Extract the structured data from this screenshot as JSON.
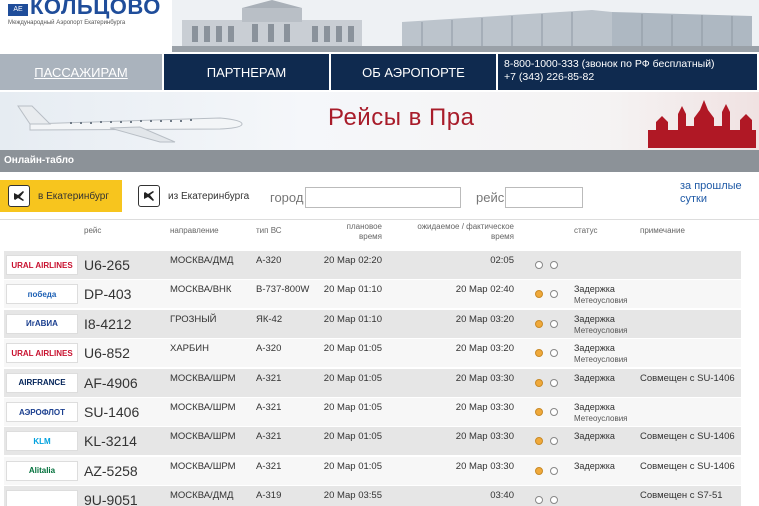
{
  "header": {
    "logo_text": "КОЛЬЦОВО",
    "logo_mark": "АЕ",
    "logo_subtitle": "Международный Аэропорт Екатеринбурга"
  },
  "nav": {
    "passengers": "ПАССАЖИРАМ",
    "partners": "ПАРТНЕРАМ",
    "about": "ОБ АЭРОПОРТЕ",
    "phone1": "8-800-1000-333 (звонок по РФ бесплатный)",
    "phone2": "+7 (343) 226-85-82"
  },
  "banner": {
    "text": "Рейсы в Пра"
  },
  "board": {
    "title": "Онлайн-табло",
    "arrivals_label": "в Екатеринбург",
    "departures_label": "из Екатеринбурга",
    "city_label": "город",
    "flight_label": "рейс",
    "past_link_line1": "за прошлые",
    "past_link_line2": "сутки"
  },
  "columns": {
    "flight": "рейс",
    "direction": "направление",
    "aircraft": "тип ВС",
    "planned_line1": "плановое",
    "planned_line2": "время",
    "expected_line1": "ожидаемое / фактическое",
    "expected_line2": "время",
    "status": "статус",
    "note": "примечание"
  },
  "flights": [
    {
      "airline": "URAL AIRLINES",
      "logo_color": "#c8102e",
      "flight": "U6-265",
      "direction": "МОСКВА/ДМД",
      "aircraft": "А-320",
      "planned": "20 Мар 02:20",
      "actual": "02:05",
      "dot1": "empty",
      "dot2": "empty",
      "status": "",
      "status_sub": "",
      "note": ""
    },
    {
      "airline": "победа",
      "logo_color": "#1b5fb4",
      "flight": "DP-403",
      "direction": "МОСКВА/ВНК",
      "aircraft": "B-737-800W",
      "planned": "20 Мар 01:10",
      "actual": "20 Мар 02:40",
      "dot1": "orange",
      "dot2": "empty",
      "status": "Задержка",
      "status_sub": "Метеоусловия",
      "note": ""
    },
    {
      "airline": "ИrАВИА",
      "logo_color": "#1b3f8f",
      "flight": "I8-4212",
      "direction": "ГРОЗНЫЙ",
      "aircraft": "ЯК-42",
      "planned": "20 Мар 01:10",
      "actual": "20 Мар 03:20",
      "dot1": "orange",
      "dot2": "empty",
      "status": "Задержка",
      "status_sub": "Метеоусловия",
      "note": ""
    },
    {
      "airline": "URAL AIRLINES",
      "logo_color": "#c8102e",
      "flight": "U6-852",
      "direction": "ХАРБИН",
      "aircraft": "А-320",
      "planned": "20 Мар 01:05",
      "actual": "20 Мар 03:20",
      "dot1": "orange",
      "dot2": "empty",
      "status": "Задержка",
      "status_sub": "Метеоусловия",
      "note": ""
    },
    {
      "airline": "AIRFRANCE",
      "logo_color": "#002157",
      "flight": "AF-4906",
      "direction": "МОСКВА/ШРМ",
      "aircraft": "А-321",
      "planned": "20 Мар 01:05",
      "actual": "20 Мар 03:30",
      "dot1": "orange",
      "dot2": "empty",
      "status": "Задержка",
      "status_sub": "",
      "note": "Совмещен с SU-1406"
    },
    {
      "airline": "АЭРОФЛОТ",
      "logo_color": "#1b3f8f",
      "flight": "SU-1406",
      "direction": "МОСКВА/ШРМ",
      "aircraft": "А-321",
      "planned": "20 Мар 01:05",
      "actual": "20 Мар 03:30",
      "dot1": "orange",
      "dot2": "empty",
      "status": "Задержка",
      "status_sub": "Метеоусловия",
      "note": ""
    },
    {
      "airline": "KLM",
      "logo_color": "#00a1de",
      "flight": "KL-3214",
      "direction": "МОСКВА/ШРМ",
      "aircraft": "А-321",
      "planned": "20 Мар 01:05",
      "actual": "20 Мар 03:30",
      "dot1": "orange",
      "dot2": "empty",
      "status": "Задержка",
      "status_sub": "",
      "note": "Совмещен с SU-1406"
    },
    {
      "airline": "Alitalia",
      "logo_color": "#006f3a",
      "flight": "AZ-5258",
      "direction": "МОСКВА/ШРМ",
      "aircraft": "А-321",
      "planned": "20 Мар 01:05",
      "actual": "20 Мар 03:30",
      "dot1": "orange",
      "dot2": "empty",
      "status": "Задержка",
      "status_sub": "",
      "note": "Совмещен с SU-1406"
    },
    {
      "airline": "",
      "logo_color": "#c8102e",
      "flight": "9U-9051",
      "direction": "МОСКВА/ДМД",
      "aircraft": "А-319",
      "planned": "20 Мар 03:55",
      "actual": "03:40",
      "dot1": "empty",
      "dot2": "empty",
      "status": "",
      "status_sub": "",
      "note": "Совмещен с S7-51"
    }
  ]
}
